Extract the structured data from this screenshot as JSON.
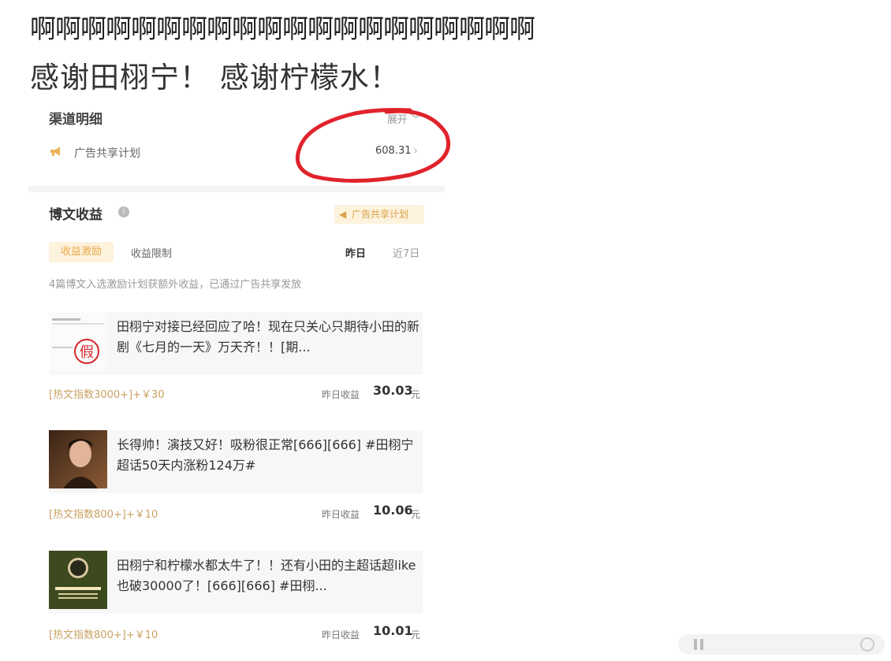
{
  "post": {
    "line1": "啊啊啊啊啊啊啊啊啊啊啊啊啊啊啊啊啊啊啊啊",
    "line2": "感谢田栩宁！ 感谢柠檬水！"
  },
  "screenshot": {
    "channel_title": "渠道明细",
    "expand_label": "展开",
    "ad_row": {
      "label": "广告共享计划",
      "value": "608.31"
    },
    "section_title": "博文收益",
    "ad_badge": "广告共享计划",
    "tabs": [
      {
        "label": "收益激励"
      },
      {
        "label": "收益限制"
      }
    ],
    "ranges": [
      {
        "label": "昨日"
      },
      {
        "label": "近7日"
      }
    ],
    "note": "4篇博文入选激励计划获额外收益，已通过广告共享发放",
    "posts": [
      {
        "text": "田栩宁对接已经回应了哈！现在只关心只期待小田的新剧《七月的一天》万天齐！！[期...",
        "reward": "[热文指数3000+]+￥30",
        "earn_label": "昨日收益",
        "earn_value": "30.03",
        "earn_unit": "元",
        "thumb_mark": "假"
      },
      {
        "text": "长得帅！演技又好！吸粉很正常[666][666] #田栩宁超话50天内涨粉124万#",
        "reward": "[热文指数800+]+￥10",
        "earn_label": "昨日收益",
        "earn_value": "10.06",
        "earn_unit": "元"
      },
      {
        "text": "田栩宁和柠檬水都太牛了！！还有小田的主超话超like也破30000了！[666][666] #田栩...",
        "reward": "[热文指数800+]+￥10",
        "earn_label": "昨日收益",
        "earn_value": "10.01",
        "earn_unit": "元"
      }
    ]
  },
  "colors": {
    "accent_gold": "#e9a84a",
    "annotation_red": "#e0232b"
  }
}
